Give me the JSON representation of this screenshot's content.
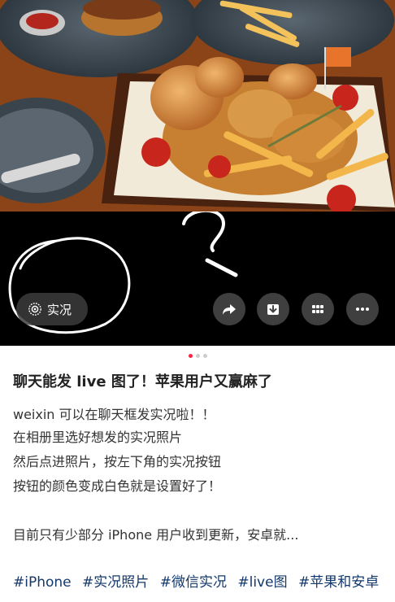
{
  "media": {
    "live_label": "实况",
    "current_slide": 1,
    "slide_count": 3
  },
  "actions": {
    "share_icon": "share-arrow-icon",
    "download_icon": "download-icon",
    "grid_icon": "grid-icon",
    "more_icon": "more-dots-icon"
  },
  "post": {
    "title": "聊天能发 live 图了！苹果用户又赢麻了",
    "lines": [
      "weixin 可以在聊天框发实况啦！！",
      "在相册里选好想发的实况照片",
      "然后点进照片，按左下角的实况按钮",
      "按钮的颜色变成白色就是设置好了！",
      "目前只有少部分 iPhone 用户收到更新，安卓就..."
    ],
    "tags": [
      "#iPhone",
      "#实况照片",
      "#微信实况",
      "#live图",
      "#苹果和安卓"
    ]
  },
  "colors": {
    "accent": "#ff2442",
    "tag": "#13386c"
  }
}
